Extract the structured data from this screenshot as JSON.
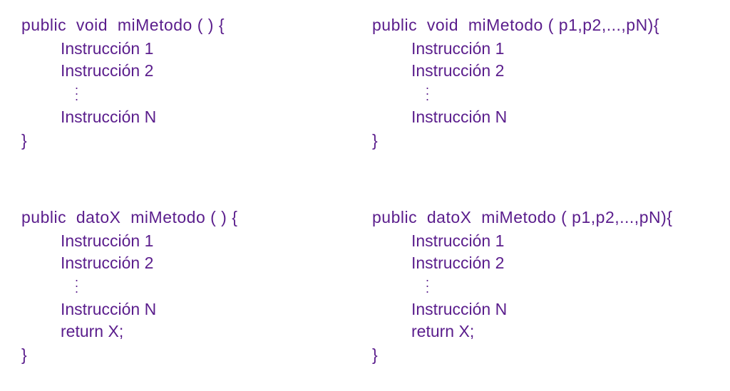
{
  "blocks": {
    "topLeft": {
      "signature": "public  void  miMetodo ( ) {",
      "instr1": "Instrucción 1",
      "instr2": "Instrucción 2",
      "instrN": "Instrucción N",
      "close": "}"
    },
    "topRight": {
      "signature": "public  void  miMetodo ( p1,p2,...,pN){",
      "instr1": "Instrucción 1",
      "instr2": "Instrucción 2",
      "instrN": "Instrucción N",
      "close": "}"
    },
    "bottomLeft": {
      "signature": "public  datoX  miMetodo ( ) {",
      "instr1": "Instrucción 1",
      "instr2": "Instrucción 2",
      "instrN": "Instrucción N",
      "return": "return X;",
      "close": "}"
    },
    "bottomRight": {
      "signature": "public  datoX  miMetodo ( p1,p2,...,pN){",
      "instr1": "Instrucción 1",
      "instr2": "Instrucción 2",
      "instrN": "Instrucción N",
      "return": "return X;",
      "close": "}"
    }
  }
}
